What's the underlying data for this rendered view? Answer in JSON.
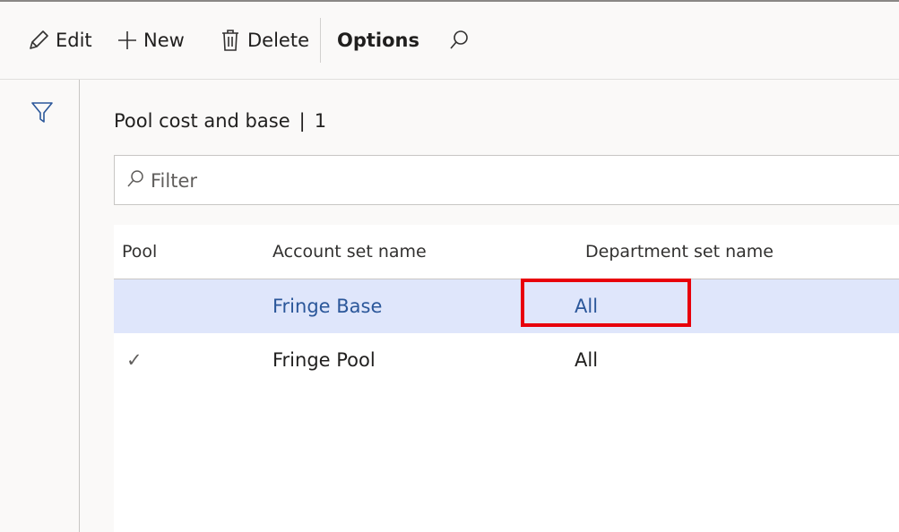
{
  "toolbar": {
    "edit_label": "Edit",
    "new_label": "New",
    "delete_label": "Delete",
    "options_label": "Options"
  },
  "caption": {
    "title": "Pool cost and base",
    "separator": "|",
    "count": "1"
  },
  "filter": {
    "placeholder": "Filter",
    "value": ""
  },
  "grid": {
    "columns": [
      "Pool",
      "Account set name",
      "Department set name"
    ],
    "rows": [
      {
        "pool_checked": false,
        "pool_mark": "",
        "account_set": "Fringe Base",
        "department_set": "All",
        "selected": true
      },
      {
        "pool_checked": true,
        "pool_mark": "✓",
        "account_set": "Fringe Pool",
        "department_set": "All",
        "selected": false
      }
    ]
  },
  "colors": {
    "selected_row": "#dfe6fb",
    "selected_text": "#2b579a",
    "highlight": "#e8000b"
  }
}
